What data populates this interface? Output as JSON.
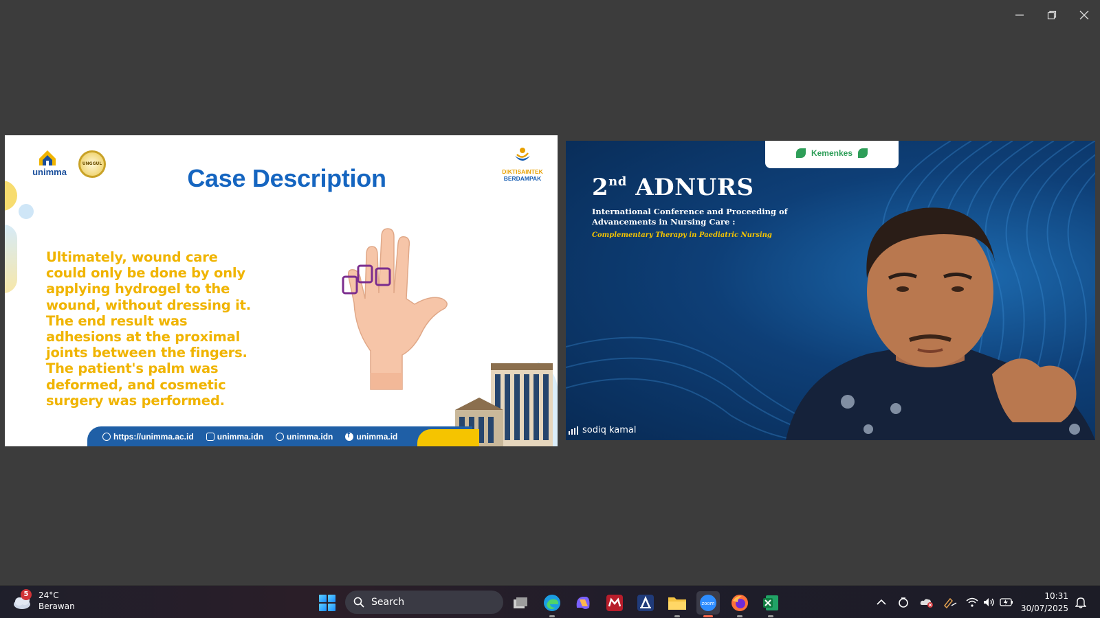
{
  "window": {
    "controls": [
      "minimize",
      "restore",
      "close"
    ]
  },
  "shared_slide": {
    "title": "Case Description",
    "logos": {
      "left_university": "unimma",
      "accreditation": "UNGGUL",
      "right_top": "DIKTISAINTEK",
      "right_bottom": "BERDAMPAK"
    },
    "body_text": "Ultimately, wound care\ncould only be done by only\napplying hydrogel to the\nwound, without dressing it.\nThe end result was\nadhesions at the proximal\njoints between the fingers.\nThe patient's palm was\ndeformed, and cosmetic\nsurgery was performed.",
    "footer": {
      "website": "https://unimma.ac.id",
      "instagram": "unimma.idn",
      "tiktok": "unimma.idn",
      "facebook": "unimma.id"
    },
    "colors": {
      "title": "#1565c0",
      "body": "#f0b400",
      "footer": "#1f5fa6"
    }
  },
  "participant": {
    "name": "sodiq kamal",
    "background": {
      "sponsor_label": "Kemenkes",
      "event_number": "2",
      "event_suffix": "nd",
      "event_name": "ADNURS",
      "subtitle": "International Conference and Proceeding of Advancements in Nursing Care :",
      "theme": "Complementary Therapy in Paediatric Nursing"
    }
  },
  "taskbar": {
    "weather": {
      "notifications": "5",
      "temperature": "24°C",
      "condition": "Berawan"
    },
    "search_label": "Search",
    "apps": [
      "task-view",
      "edge",
      "copilot",
      "mendeley",
      "app-a",
      "file-explorer",
      "zoom",
      "firefox",
      "excel"
    ],
    "clock": {
      "time": "10:31",
      "date": "30/07/2025"
    }
  }
}
